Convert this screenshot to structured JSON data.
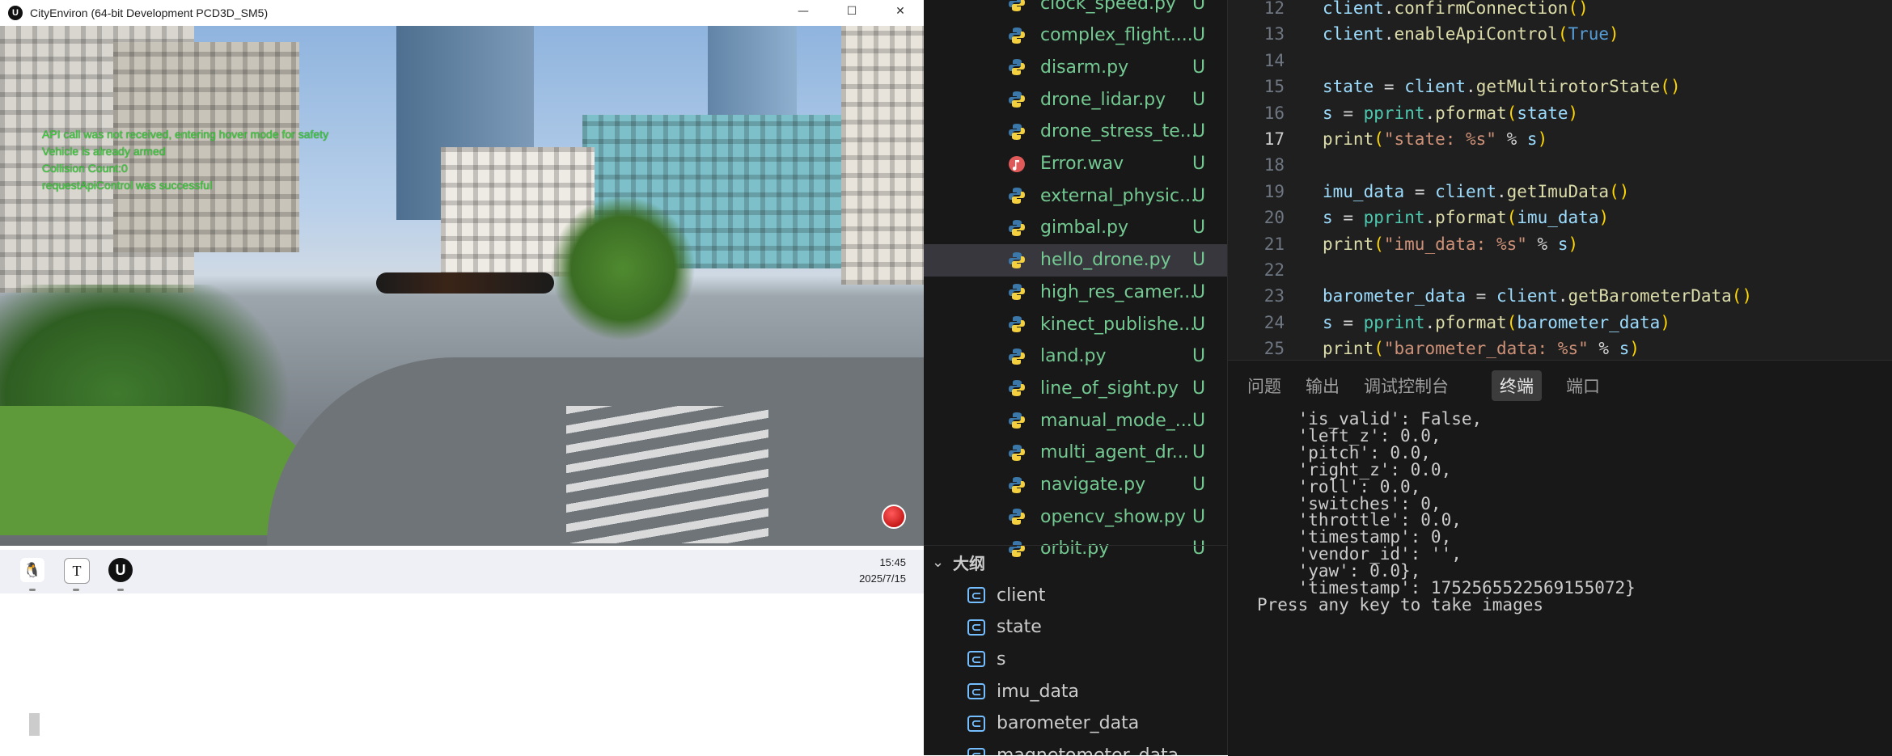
{
  "game_window": {
    "title": "CityEnviron (64-bit Development PCD3D_SM5)",
    "app_icon_glyph": "U",
    "controls": {
      "minimize": "—",
      "maximize": "☐",
      "close": "✕"
    },
    "hud": [
      "API call was not received, entering hover mode for safety",
      "Vehicle is already armed",
      "Collision Count:0",
      "requestApiControl was successful"
    ]
  },
  "taskbar": {
    "apps": [
      {
        "name": "qq",
        "glyph": "🐧"
      },
      {
        "name": "typora",
        "glyph": "T"
      },
      {
        "name": "unreal",
        "glyph": "U"
      }
    ],
    "time": "15:45",
    "date": "2025/7/15"
  },
  "explorer": {
    "files": [
      {
        "name": "clock_speed.py",
        "status": "U",
        "icon": "python-icon"
      },
      {
        "name": "complex_flight....",
        "status": "U",
        "icon": "python-icon"
      },
      {
        "name": "disarm.py",
        "status": "U",
        "icon": "python-icon"
      },
      {
        "name": "drone_lidar.py",
        "status": "U",
        "icon": "python-icon"
      },
      {
        "name": "drone_stress_te...",
        "status": "U",
        "icon": "python-icon"
      },
      {
        "name": "Error.wav",
        "status": "U",
        "icon": "audio-icon"
      },
      {
        "name": "external_physic...",
        "status": "U",
        "icon": "python-icon"
      },
      {
        "name": "gimbal.py",
        "status": "U",
        "icon": "python-icon"
      },
      {
        "name": "hello_drone.py",
        "status": "U",
        "icon": "python-icon",
        "active": true
      },
      {
        "name": "high_res_camer...",
        "status": "U",
        "icon": "python-icon"
      },
      {
        "name": "kinect_publishe...",
        "status": "U",
        "icon": "python-icon"
      },
      {
        "name": "land.py",
        "status": "U",
        "icon": "python-icon"
      },
      {
        "name": "line_of_sight.py",
        "status": "U",
        "icon": "python-icon"
      },
      {
        "name": "manual_mode_...",
        "status": "U",
        "icon": "python-icon"
      },
      {
        "name": "multi_agent_dr...",
        "status": "U",
        "icon": "python-icon"
      },
      {
        "name": "navigate.py",
        "status": "U",
        "icon": "python-icon"
      },
      {
        "name": "opencv_show.py",
        "status": "U",
        "icon": "python-icon"
      },
      {
        "name": "orbit.py",
        "status": "U",
        "icon": "python-icon"
      }
    ],
    "outline": {
      "title": "大纲",
      "items": [
        "client",
        "state",
        "s",
        "imu_data",
        "barometer_data",
        "magnetometer_data"
      ]
    }
  },
  "editor": {
    "lines": [
      {
        "num": "12",
        "code": "client.confirmConnection()"
      },
      {
        "num": "13",
        "code": "client.enableApiControl(True)"
      },
      {
        "num": "14",
        "code": ""
      },
      {
        "num": "15",
        "code": "state = client.getMultirotorState()"
      },
      {
        "num": "16",
        "code": "s = pprint.pformat(state)"
      },
      {
        "num": "17",
        "code": "print(\"state: %s\" % s)",
        "current": true
      },
      {
        "num": "18",
        "code": ""
      },
      {
        "num": "19",
        "code": "imu_data = client.getImuData()"
      },
      {
        "num": "20",
        "code": "s = pprint.pformat(imu_data)"
      },
      {
        "num": "21",
        "code": "print(\"imu_data: %s\" % s)"
      },
      {
        "num": "22",
        "code": ""
      },
      {
        "num": "23",
        "code": "barometer_data = client.getBarometerData()"
      },
      {
        "num": "24",
        "code": "s = pprint.pformat(barometer_data)"
      },
      {
        "num": "25",
        "code": "print(\"barometer_data: %s\" % s)"
      }
    ]
  },
  "panel": {
    "tabs": [
      "问题",
      "输出",
      "调试控制台",
      "终端",
      "端口"
    ],
    "active_tab": "终端",
    "terminal": [
      "    'is_valid': False,",
      "    'left_z': 0.0,",
      "    'pitch': 0.0,",
      "    'right_z': 0.0,",
      "    'roll': 0.0,",
      "    'switches': 0,",
      "    'throttle': 0.0,",
      "    'timestamp': 0,",
      "    'vendor_id': '',",
      "    'yaw': 0.0},",
      "    'timestamp': 1752565522569155072}",
      "Press any key to take images"
    ]
  },
  "colors": {
    "git_untracked": "#73c991",
    "editor_bg": "#1f1f1f",
    "sidebar_bg": "#181818",
    "hud_green": "#3ad13a"
  }
}
